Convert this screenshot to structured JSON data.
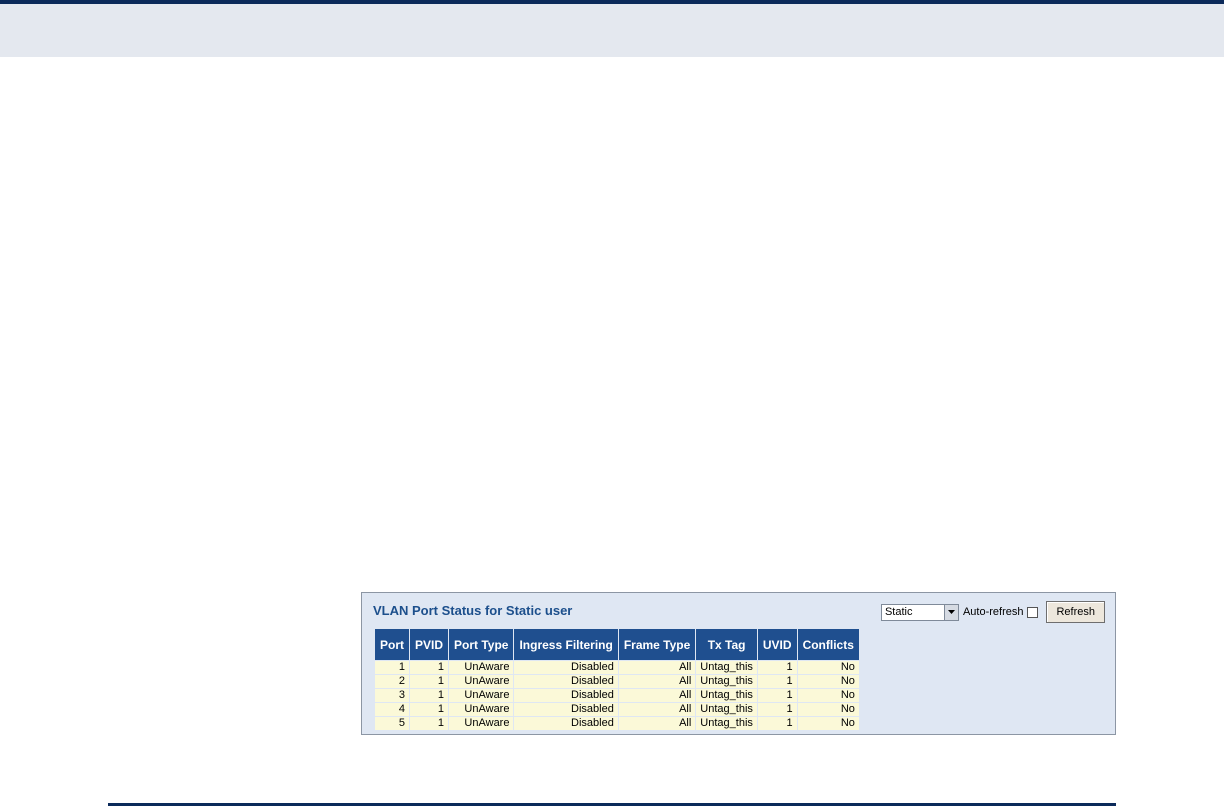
{
  "panel": {
    "title": "VLAN Port Status for Static user",
    "select": {
      "value": "Static"
    },
    "auto_refresh_label": "Auto-refresh",
    "auto_refresh_checked": false,
    "refresh_button": "Refresh"
  },
  "table": {
    "headers": [
      "Port",
      "PVID",
      "Port Type",
      "Ingress Filtering",
      "Frame Type",
      "Tx Tag",
      "UVID",
      "Conflicts"
    ],
    "rows": [
      [
        "1",
        "1",
        "UnAware",
        "Disabled",
        "All",
        "Untag_this",
        "1",
        "No"
      ],
      [
        "2",
        "1",
        "UnAware",
        "Disabled",
        "All",
        "Untag_this",
        "1",
        "No"
      ],
      [
        "3",
        "1",
        "UnAware",
        "Disabled",
        "All",
        "Untag_this",
        "1",
        "No"
      ],
      [
        "4",
        "1",
        "UnAware",
        "Disabled",
        "All",
        "Untag_this",
        "1",
        "No"
      ],
      [
        "5",
        "1",
        "UnAware",
        "Disabled",
        "All",
        "Untag_this",
        "1",
        "No"
      ]
    ]
  },
  "colors": {
    "header_bg": "#1f4f8f",
    "cell_bg": "#fbf9d8",
    "panel_bg": "#dfe7f3",
    "title_color": "#1c4f8c"
  }
}
